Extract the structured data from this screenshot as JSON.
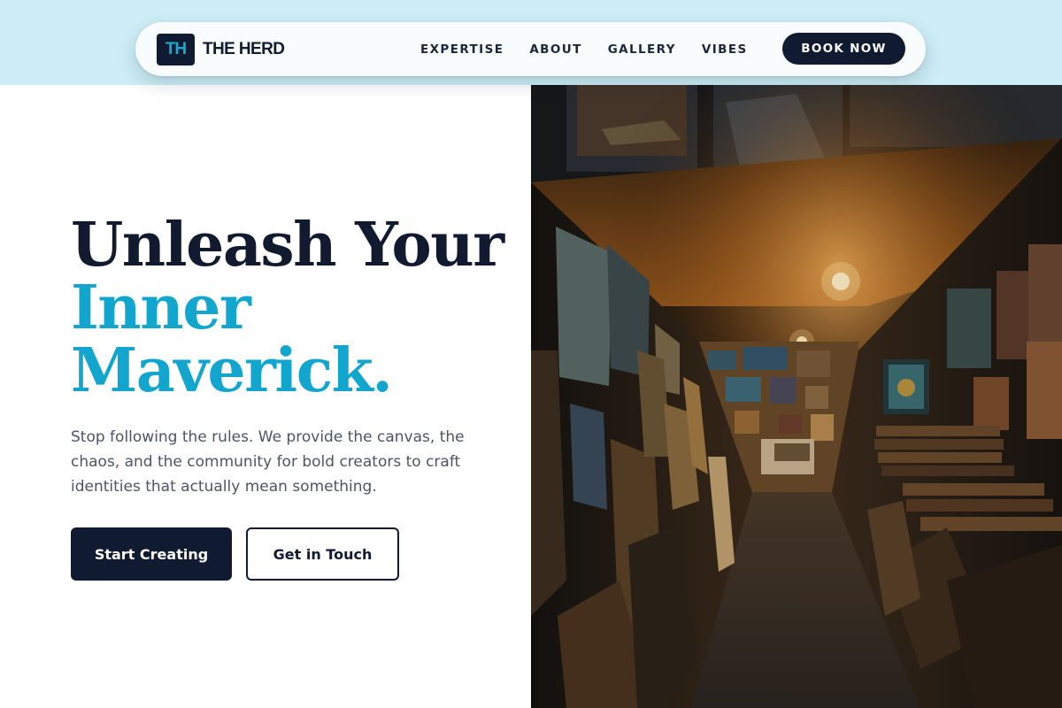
{
  "brand": {
    "logo_mark": "TH",
    "name": "THE HERD",
    "mark_color": "#101a31",
    "accent_color": "#12a6cf"
  },
  "nav": {
    "links": [
      "EXPERTISE",
      "ABOUT",
      "GALLERY",
      "VIBES"
    ],
    "cta_label": "BOOK NOW"
  },
  "hero": {
    "headline_line1": "Unleash Your",
    "headline_line2": "Inner",
    "headline_line3": "Maverick.",
    "subtext": "Stop following the rules. We provide the canvas, the chaos, and the community for bold creators to craft identities that actually mean something.",
    "primary_button": "Start Creating",
    "secondary_button": "Get in Touch"
  },
  "image": {
    "subject": "art-gallery-corridor-photo"
  },
  "colors": {
    "top_band": "#cdeef6",
    "navy": "#101a31",
    "cyan": "#12a6cf",
    "body_text": "#4c5565"
  }
}
